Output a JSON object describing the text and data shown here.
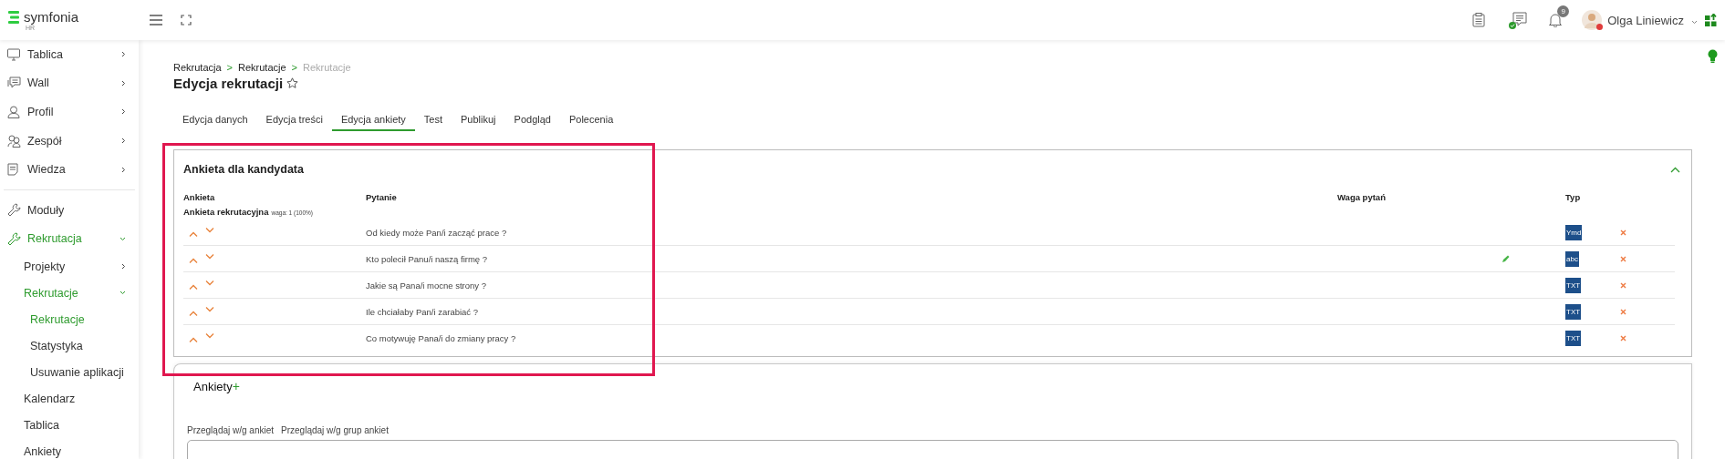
{
  "brand": {
    "name": "symfonia",
    "sub": "HR"
  },
  "header": {
    "notifications_count": "9",
    "user_name": "Olga Liniewicz",
    "user_online": false,
    "messages_online": true
  },
  "sidebar": {
    "sections": [
      {
        "items": [
          {
            "label": "Tablica",
            "expanded": false,
            "selected": false
          },
          {
            "label": "Wall",
            "expanded": false,
            "selected": false
          },
          {
            "label": "Profil",
            "expanded": false,
            "selected": false
          },
          {
            "label": "Zespół",
            "expanded": false,
            "selected": false
          },
          {
            "label": "Wiedza",
            "expanded": false,
            "selected": false
          }
        ]
      },
      {
        "items": [
          {
            "label": "Moduły",
            "selected": false
          },
          {
            "label": "Rekrutacja",
            "expanded": true,
            "selected": true,
            "children": [
              {
                "label": "Projekty",
                "expanded": false,
                "selected": false
              },
              {
                "label": "Rekrutacje",
                "expanded": true,
                "selected": true,
                "children": [
                  {
                    "label": "Rekrutacje",
                    "selected": true
                  },
                  {
                    "label": "Statystyka",
                    "selected": false
                  },
                  {
                    "label": "Usuwanie aplikacji",
                    "selected": false
                  }
                ]
              },
              {
                "label": "Kalendarz",
                "selected": false
              },
              {
                "label": "Tablica",
                "selected": false
              },
              {
                "label": "Ankiety",
                "selected": false
              }
            ]
          }
        ]
      }
    ]
  },
  "breadcrumbs": [
    {
      "label": "Rekrutacja",
      "current": false
    },
    {
      "label": "Rekrutacje",
      "current": false
    },
    {
      "label": "Rekrutacje",
      "current": true
    }
  ],
  "breadcrumb_separator": ">",
  "page_title": "Edycja rekrutacji",
  "favorite": false,
  "tabs": [
    {
      "label": "Edycja danych",
      "selected": false
    },
    {
      "label": "Edycja treści",
      "selected": false
    },
    {
      "label": "Edycja ankiety",
      "selected": true
    },
    {
      "label": "Test",
      "selected": false
    },
    {
      "label": "Publikuj",
      "selected": false
    },
    {
      "label": "Podgląd",
      "selected": false
    },
    {
      "label": "Polecenia",
      "selected": false
    }
  ],
  "survey_card": {
    "title": "Ankieta dla kandydata",
    "expanded": true,
    "highlighted": true,
    "columns": [
      "Ankieta",
      "Pytanie",
      "Waga pytań",
      "Typ"
    ],
    "survey_name": "Ankieta rekrutacyjna",
    "survey_weight": "waga: 1 (100%)",
    "rows": [
      {
        "question": "Od kiedy może Pan/i zacząć prace ?",
        "type": "Ymd",
        "editable": false
      },
      {
        "question": "Kto polecił Panu/i naszą firmę ?",
        "type": "abc",
        "editable": true
      },
      {
        "question": "Jakie są Pana/i mocne strony ?",
        "type": "TXT",
        "editable": false
      },
      {
        "question": "Ile chciałaby Pan/i zarabiać ?",
        "type": "TXT",
        "editable": false
      },
      {
        "question": "Co motywuję Pana/i do zmiany pracy ?",
        "type": "TXT",
        "editable": false
      }
    ]
  },
  "surveys_panel": {
    "title": "Ankiety",
    "add_label": "+",
    "filters": [
      "Przeglądaj w/g ankiet",
      "Przeglądaj w/g grup ankiet"
    ]
  }
}
